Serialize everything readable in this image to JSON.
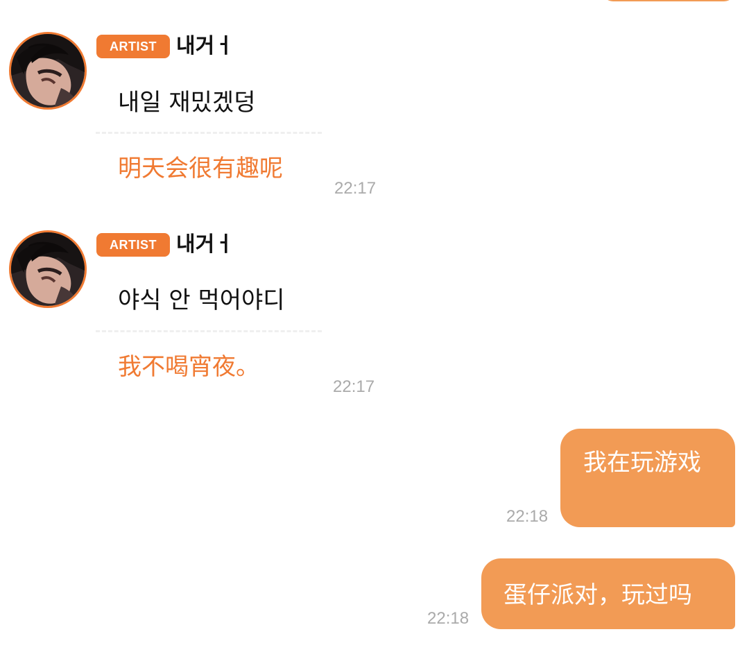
{
  "theme": {
    "accent": "#f07a32",
    "bubble": "#f29b55",
    "timestamp": "#aaaaaa"
  },
  "artist_messages": [
    {
      "badge": "ARTIST",
      "name": "내거ㅓ",
      "original": "내일 재밌겠덩",
      "translation": "明天会很有趣呢",
      "time": "22:17",
      "avatar_icon": "artist-avatar"
    },
    {
      "badge": "ARTIST",
      "name": "내거ㅓ",
      "original": "야식 안 먹어야디",
      "translation": "我不喝宵夜。",
      "time": "22:17",
      "avatar_icon": "artist-avatar"
    }
  ],
  "user_messages": [
    {
      "text": "我在玩游戏",
      "time": "22:18"
    },
    {
      "text": "蛋仔派对，玩过吗",
      "time": "22:18"
    }
  ]
}
